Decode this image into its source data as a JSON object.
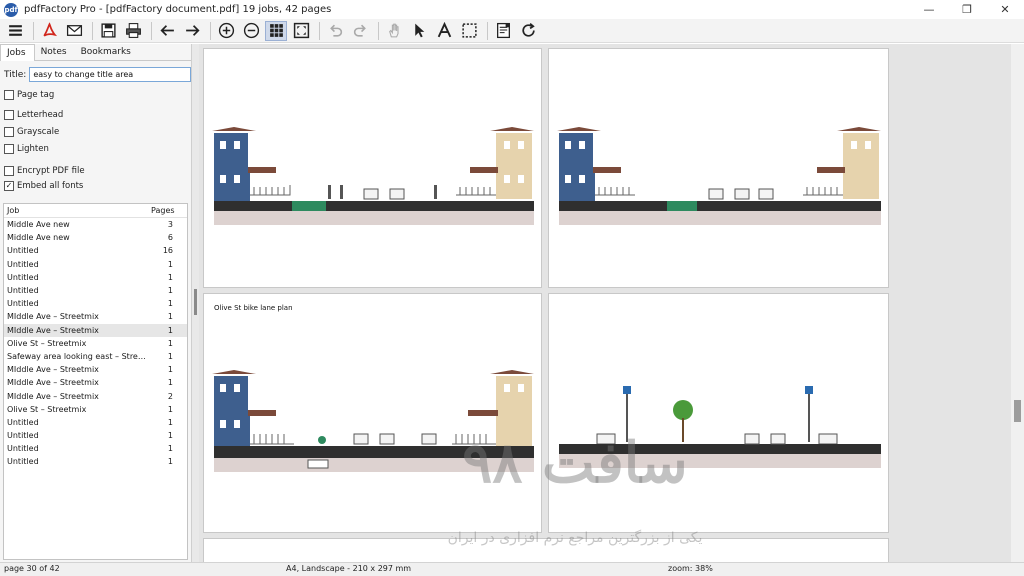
{
  "window": {
    "title": "pdfFactory Pro - [pdfFactory document.pdf] 19 jobs, 42 pages",
    "app_icon_text": "pdf",
    "minimize": "—",
    "restore": "❐",
    "close": "✕"
  },
  "toolbar": {
    "items": [
      "menu-icon",
      "acrobat-icon",
      "email-icon",
      "save-icon",
      "print-icon",
      "back-arrow-icon",
      "forward-arrow-icon",
      "zoom-in-icon",
      "zoom-out-icon",
      "grid-view-icon",
      "fit-page-icon",
      "undo-icon",
      "redo-icon",
      "hand-tool-icon",
      "select-arrow-icon",
      "text-tool-icon",
      "marquee-select-icon",
      "page-properties-icon",
      "refresh-icon"
    ]
  },
  "sidebar": {
    "tabs": [
      {
        "label": "Jobs"
      },
      {
        "label": "Notes"
      },
      {
        "label": "Bookmarks"
      }
    ],
    "title_label": "Title:",
    "title_value": "easy to change title area",
    "options": [
      {
        "label": "Page tag",
        "checked": false
      },
      {
        "label": "Letterhead",
        "checked": false
      },
      {
        "label": "Grayscale",
        "checked": false
      },
      {
        "label": "Lighten",
        "checked": false
      },
      {
        "label": "Encrypt PDF file",
        "checked": false
      },
      {
        "label": "Embed all fonts",
        "checked": true
      }
    ],
    "jobs_header": {
      "job": "Job",
      "pages": "Pages"
    },
    "jobs": [
      {
        "name": "Middle Ave new",
        "pages": "3"
      },
      {
        "name": "Middle Ave new",
        "pages": "6"
      },
      {
        "name": "Untitled",
        "pages": "16"
      },
      {
        "name": "Untitled",
        "pages": "1"
      },
      {
        "name": "Untitled",
        "pages": "1"
      },
      {
        "name": "Untitled",
        "pages": "1"
      },
      {
        "name": "Untitled",
        "pages": "1"
      },
      {
        "name": "MIddle Ave – Streetmix",
        "pages": "1"
      },
      {
        "name": "MIddle Ave – Streetmix",
        "pages": "1"
      },
      {
        "name": "Olive St – Streetmix",
        "pages": "1"
      },
      {
        "name": "Safeway area looking east – Street…",
        "pages": "1"
      },
      {
        "name": "MIddle Ave – Streetmix",
        "pages": "1"
      },
      {
        "name": "MIddle Ave – Streetmix",
        "pages": "1"
      },
      {
        "name": "MIddle Ave – Streetmix",
        "pages": "2"
      },
      {
        "name": "Olive St – Streetmix",
        "pages": "1"
      },
      {
        "name": "Untitled",
        "pages": "1"
      },
      {
        "name": "Untitled",
        "pages": "1"
      },
      {
        "name": "Untitled",
        "pages": "1"
      },
      {
        "name": "Untitled",
        "pages": "1"
      }
    ]
  },
  "document": {
    "page3_caption": "Olive St bike lane plan"
  },
  "status": {
    "page": "page 30 of 42",
    "format": "A4, Landscape - 210 x 297 mm",
    "zoom": "zoom: 38%"
  },
  "watermark": {
    "big": "سافت ۹۸",
    "small": "یکی از بزرگترین مراجع نرم افزاری در ایران"
  },
  "colors": {
    "house_blue": "#3e5f8e",
    "house_tan": "#e6d3ad",
    "roof_brown": "#7b4a3a",
    "road": "#2f2f2f",
    "sidewalk": "#ddd2d0",
    "bike_lane": "#2e8a5f",
    "accent": "#2a5caa"
  }
}
